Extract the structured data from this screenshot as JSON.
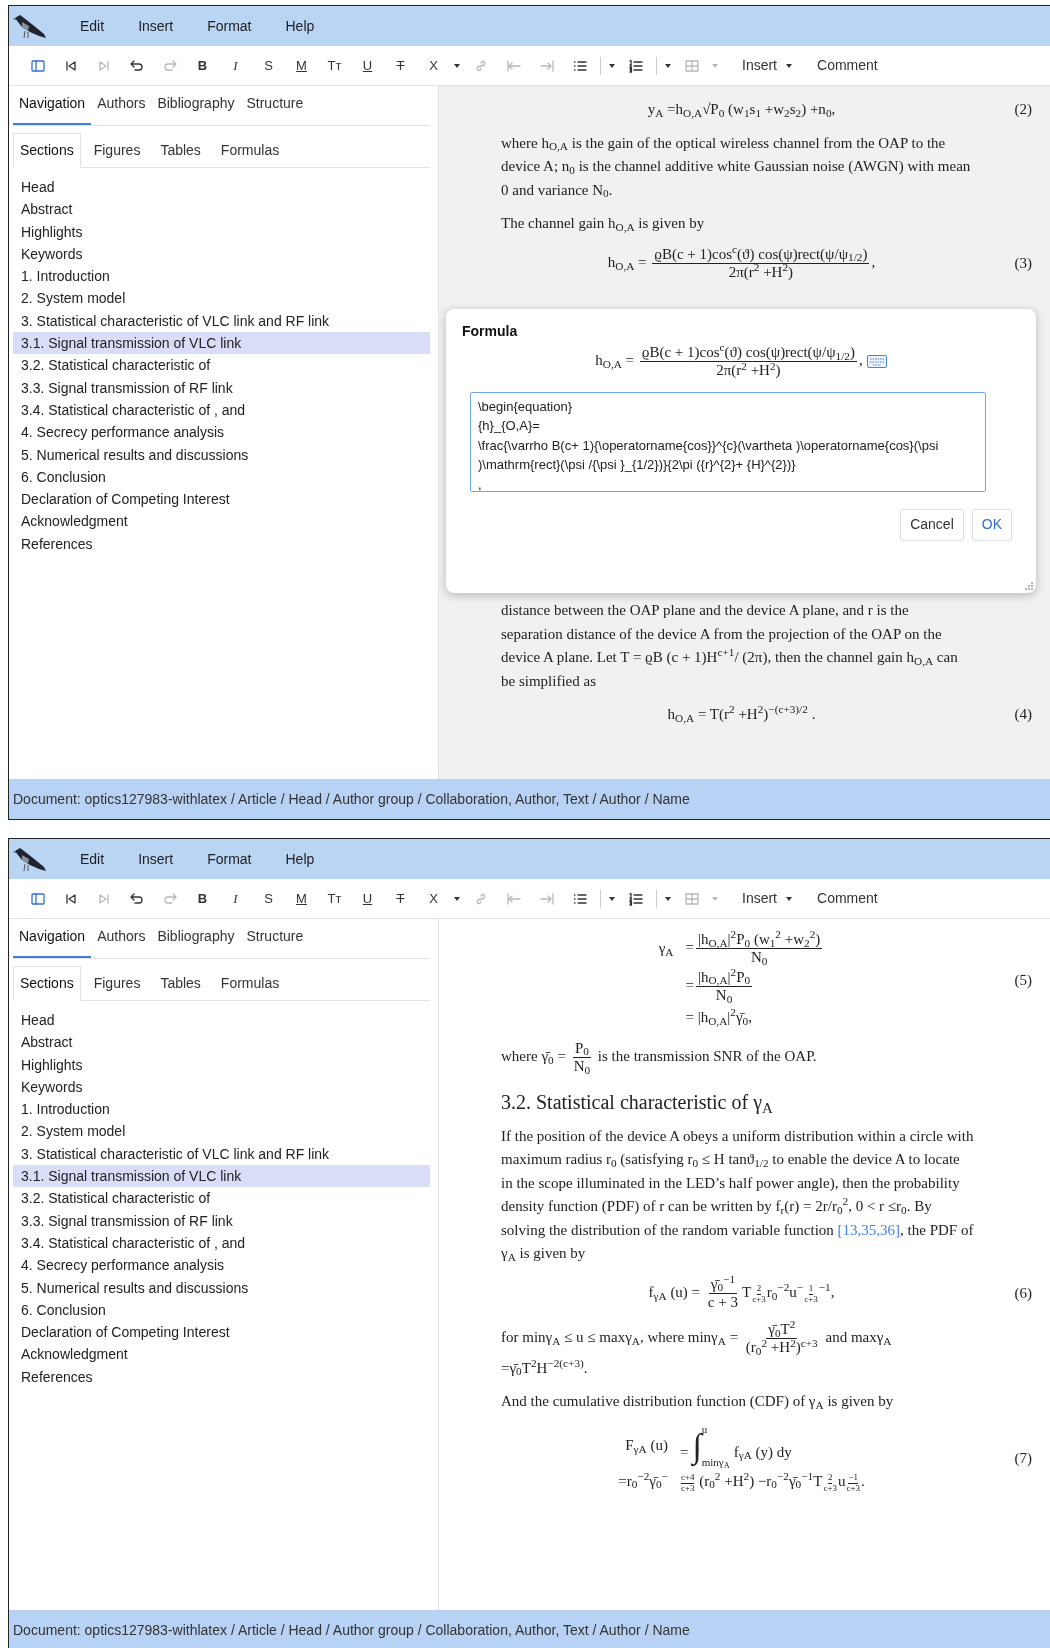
{
  "windows": [
    {
      "menu": [
        "Edit",
        "Insert",
        "Format",
        "Help"
      ],
      "toolbar": [
        {
          "kind": "sidebar",
          "disabled": false
        },
        {
          "kind": "first",
          "disabled": false
        },
        {
          "kind": "last",
          "disabled": true
        },
        {
          "kind": "undo",
          "disabled": false
        },
        {
          "kind": "redo",
          "disabled": true
        },
        {
          "kind": "bold",
          "label": "B",
          "disabled": false
        },
        {
          "kind": "italic",
          "label": "I",
          "disabled": false
        },
        {
          "kind": "plain",
          "label": "S",
          "disabled": false
        },
        {
          "kind": "underline",
          "label": "M",
          "disabled": false
        },
        {
          "kind": "plain",
          "label": "Tᴛ",
          "disabled": false
        },
        {
          "kind": "underline",
          "label": "U",
          "disabled": false
        },
        {
          "kind": "strike",
          "label": "T",
          "disabled": false
        },
        {
          "kind": "plain",
          "label": "X",
          "disabled": false
        },
        {
          "kind": "caret",
          "disabled": false
        },
        {
          "kind": "link",
          "disabled": true
        },
        {
          "kind": "outdent",
          "disabled": true
        },
        {
          "kind": "indent",
          "disabled": true
        },
        {
          "kind": "bullets",
          "disabled": false
        },
        {
          "kind": "sep",
          "disabled": false
        },
        {
          "kind": "caret",
          "disabled": false
        },
        {
          "kind": "numbers",
          "disabled": false
        },
        {
          "kind": "sep",
          "disabled": false
        },
        {
          "kind": "caret",
          "disabled": false
        },
        {
          "kind": "table",
          "disabled": true
        },
        {
          "kind": "caret",
          "disabled": true
        },
        {
          "kind": "menu",
          "label": "Insert",
          "disabled": false
        },
        {
          "kind": "button",
          "label": "Comment",
          "disabled": false
        }
      ],
      "nav_tabs": [
        {
          "label": "Navigation",
          "selected": true
        },
        {
          "label": "Authors",
          "selected": false
        },
        {
          "label": "Bibliography",
          "selected": false
        },
        {
          "label": "Structure",
          "selected": false
        }
      ],
      "sub_tabs": [
        {
          "label": "Sections",
          "selected": true
        },
        {
          "label": "Figures",
          "selected": false
        },
        {
          "label": "Tables",
          "selected": false
        },
        {
          "label": "Formulas",
          "selected": false
        }
      ],
      "sections": [
        {
          "label": "Head",
          "selected": false
        },
        {
          "label": "Abstract",
          "selected": false
        },
        {
          "label": "Highlights",
          "selected": false
        },
        {
          "label": "Keywords",
          "selected": false
        },
        {
          "label": "1. Introduction",
          "selected": false
        },
        {
          "label": "2. System model",
          "selected": false
        },
        {
          "label": "3. Statistical characteristic of VLC link and RF link",
          "selected": false
        },
        {
          "label": "3.1. Signal transmission of VLC link",
          "selected": true
        },
        {
          "label": "3.2. Statistical characteristic of",
          "selected": false
        },
        {
          "label": "3.3. Signal transmission of RF link",
          "selected": false
        },
        {
          "label": "3.4. Statistical characteristic of , and",
          "selected": false
        },
        {
          "label": "4. Secrecy performance analysis",
          "selected": false
        },
        {
          "label": "5. Numerical results and discussions",
          "selected": false
        },
        {
          "label": "6. Conclusion",
          "selected": false
        },
        {
          "label": "Declaration of Competing Interest",
          "selected": false
        },
        {
          "label": "Acknowledgment",
          "selected": false
        },
        {
          "label": "References",
          "selected": false
        }
      ],
      "document": [
        {
          "kind": "equation",
          "number": "(2)",
          "lines": [
            [
              {
                "kind": "text",
                "text": "y$_{A}$ =h$_{O,A}$√P$_{0}$ (w$_{1}$s$_{1}$ +w$_{2}$s$_{2}$) +n$_{0}$,"
              }
            ]
          ]
        },
        {
          "kind": "paragraph",
          "parts": [
            {
              "kind": "text",
              "text": "where h$_{O,A}$ is the gain of the optical wireless channel from the OAP to the device A; n$_{0}$ is the channel additive white Gaussian noise (AWGN) with mean 0 and variance N$_{0}$."
            }
          ]
        },
        {
          "kind": "paragraph",
          "parts": [
            {
              "kind": "text",
              "text": "The channel gain h$_{O,A}$ is given by"
            }
          ]
        },
        {
          "kind": "equation",
          "number": "(3)",
          "lines": [
            [
              {
                "kind": "text",
                "text": "h$_{O,A}$ = "
              },
              {
                "kind": "frac",
                "num": "ϱB(c + 1)cos$^{c}$(ϑ) cos(ψ)rect(ψ/ψ$_{1/2}$)",
                "den": "2π(r$^{2}$ +H$^{2}$)"
              },
              {
                "kind": "text",
                "text": ","
              }
            ]
          ]
        },
        {
          "kind": "hidden"
        },
        {
          "kind": "paragraph",
          "parts": [
            {
              "kind": "text",
              "text": "distance between the OAP plane and the device A plane, and r is the separation distance of the device A from the projection of the OAP on the device A plane. Let T = ϱB (c + 1)H$^{c+1}$/ (2π), then the channel gain h$_{O,A}$ can be simplified as"
            }
          ]
        },
        {
          "kind": "equation",
          "number": "(4)",
          "lines": [
            [
              {
                "kind": "text",
                "text": "h$_{O,A}$ = T(r$^{2}$ +H$^{2}$)$^{−(c+3)/2}$ ."
              }
            ]
          ]
        }
      ],
      "dialog": {
        "title": "Formula",
        "preview": [
          {
            "kind": "text",
            "text": "h$_{O,A}$ = "
          },
          {
            "kind": "frac",
            "num": "ϱB(c + 1)cos$^{c}$(ϑ) cos(ψ)rect(ψ/ψ$_{1/2}$)",
            "den": "2π(r$^{2}$ +H$^{2}$)"
          },
          {
            "kind": "text",
            "text": ","
          }
        ],
        "latex": "\\begin{equation}\n{h}_{O,A}=\n\\frac{\\varrho B(c+ 1){\\operatorname{cos}}^{c}(\\vartheta )\\operatorname{cos}(\\psi )\\mathrm{rect}(\\psi /{\\psi }_{1/2})}{2\\pi ({r}^{2}+ {H}^{2})}\n,",
        "buttons": [
          "Cancel",
          "OK"
        ]
      },
      "status_bar": "Document: optics127983-withlatex / Article / Head / Author group / Collaboration, Author, Text / Author / Name"
    },
    {
      "menu": [
        "Edit",
        "Insert",
        "Format",
        "Help"
      ],
      "toolbar": [
        {
          "kind": "sidebar",
          "disabled": false
        },
        {
          "kind": "first",
          "disabled": false
        },
        {
          "kind": "last",
          "disabled": true
        },
        {
          "kind": "undo",
          "disabled": false
        },
        {
          "kind": "redo",
          "disabled": true
        },
        {
          "kind": "bold",
          "label": "B",
          "disabled": false
        },
        {
          "kind": "italic",
          "label": "I",
          "disabled": false
        },
        {
          "kind": "plain",
          "label": "S",
          "disabled": false
        },
        {
          "kind": "underline",
          "label": "M",
          "disabled": false
        },
        {
          "kind": "plain",
          "label": "Tᴛ",
          "disabled": false
        },
        {
          "kind": "underline",
          "label": "U",
          "disabled": false
        },
        {
          "kind": "strike",
          "label": "T",
          "disabled": false
        },
        {
          "kind": "plain",
          "label": "X",
          "disabled": false
        },
        {
          "kind": "caret",
          "disabled": false
        },
        {
          "kind": "link",
          "disabled": true
        },
        {
          "kind": "outdent",
          "disabled": true
        },
        {
          "kind": "indent",
          "disabled": true
        },
        {
          "kind": "bullets",
          "disabled": false
        },
        {
          "kind": "sep",
          "disabled": false
        },
        {
          "kind": "caret",
          "disabled": false
        },
        {
          "kind": "numbers",
          "disabled": false
        },
        {
          "kind": "sep",
          "disabled": false
        },
        {
          "kind": "caret",
          "disabled": false
        },
        {
          "kind": "table",
          "disabled": true
        },
        {
          "kind": "caret",
          "disabled": true
        },
        {
          "kind": "menu",
          "label": "Insert",
          "disabled": false
        },
        {
          "kind": "button",
          "label": "Comment",
          "disabled": false
        }
      ],
      "nav_tabs": [
        {
          "label": "Navigation",
          "selected": true
        },
        {
          "label": "Authors",
          "selected": false
        },
        {
          "label": "Bibliography",
          "selected": false
        },
        {
          "label": "Structure",
          "selected": false
        }
      ],
      "sub_tabs": [
        {
          "label": "Sections",
          "selected": true
        },
        {
          "label": "Figures",
          "selected": false
        },
        {
          "label": "Tables",
          "selected": false
        },
        {
          "label": "Formulas",
          "selected": false
        }
      ],
      "sections": [
        {
          "label": "Head",
          "selected": false
        },
        {
          "label": "Abstract",
          "selected": false
        },
        {
          "label": "Highlights",
          "selected": false
        },
        {
          "label": "Keywords",
          "selected": false
        },
        {
          "label": "1. Introduction",
          "selected": false
        },
        {
          "label": "2. System model",
          "selected": false
        },
        {
          "label": "3. Statistical characteristic of VLC link and RF link",
          "selected": false
        },
        {
          "label": "3.1. Signal transmission of VLC link",
          "selected": true
        },
        {
          "label": "3.2. Statistical characteristic of",
          "selected": false
        },
        {
          "label": "3.3. Signal transmission of RF link",
          "selected": false
        },
        {
          "label": "3.4. Statistical characteristic of , and",
          "selected": false
        },
        {
          "label": "4. Secrecy performance analysis",
          "selected": false
        },
        {
          "label": "5. Numerical results and discussions",
          "selected": false
        },
        {
          "label": "6. Conclusion",
          "selected": false
        },
        {
          "label": "Declaration of Competing Interest",
          "selected": false
        },
        {
          "label": "Acknowledgment",
          "selected": false
        },
        {
          "label": "References",
          "selected": false
        }
      ],
      "document": [
        {
          "kind": "equation",
          "number": "(5)",
          "lines": [
            [
              {
                "kind": "text",
                "text": "γ$_{A}$"
              },
              {
                "kind": "text",
                "text": "="
              },
              {
                "kind": "frac",
                "num": "|h$_{O,A}$|$^{2}$P$_{0}$ (w$_{1}$$^{2}$ +w$_{2}$$^{2}$)",
                "den": "N$_{0}$"
              }
            ],
            [
              {
                "kind": "text",
                "text": "="
              },
              {
                "kind": "frac",
                "num": "|h$_{O,A}$|$^{2}$P$_{0}$",
                "den": "N$_{0}$"
              }
            ],
            [
              {
                "kind": "text",
                "text": "= |h$_{O,A}$|$^{2}$γ̄$_{0}$,"
              }
            ]
          ]
        },
        {
          "kind": "paragraph",
          "parts": [
            {
              "kind": "text",
              "text": "where γ̄$_{0}$ = "
            },
            {
              "kind": "frac",
              "num": "P$_{0}$",
              "den": "N$_{0}$"
            },
            {
              "kind": "text",
              "text": " is the transmission SNR of the OAP."
            }
          ]
        },
        {
          "kind": "heading",
          "text": "3.2. Statistical characteristic of γ$_{A}$"
        },
        {
          "kind": "paragraph",
          "parts": [
            {
              "kind": "text",
              "text": "If the position of the device A obeys a uniform distribution within a circle with maximum radius r$_{0}$ (satisfying r$_{0}$ ≤ H tanϑ$_{1/2}$ to enable the device A to locate in the scope illuminated in the LED’s half power angle), then the probability density function (PDF) of r can be written by f$_{r}$(r) = 2r/r$_{0}$$^{2}$, 0 < r ≤r$_{0}$. By solving the distribution of the random variable function "
            },
            {
              "kind": "link",
              "text": "[13,35,36]"
            },
            {
              "kind": "text",
              "text": ", the PDF of γ$_{A}$ is given by"
            }
          ]
        },
        {
          "kind": "equation",
          "number": "(6)",
          "lines": [
            [
              {
                "kind": "text",
                "text": "f$_{γA}$ (u) = "
              },
              {
                "kind": "frac",
                "num": "γ̄$_{0}$$^{−1}$",
                "den": "c + 3"
              },
              {
                "kind": "text",
                "text": "T"
              },
              {
                "kind": "supfrac",
                "num": "2",
                "den": "c+3"
              },
              {
                "kind": "text",
                "text": "r$_{0}$$^{−2}$u$^{−}$"
              },
              {
                "kind": "supfrac",
                "num": "1",
                "den": "c+3"
              },
              {
                "kind": "text",
                "text": "$^{−1}$,"
              }
            ]
          ]
        },
        {
          "kind": "paragraph",
          "parts": [
            {
              "kind": "text",
              "text": "for minγ$_{A}$ ≤ u ≤ maxγ$_{A}$, where minγ$_{A}$ = "
            },
            {
              "kind": "frac",
              "num": "γ̄$_{0}$T$^{2}$",
              "den": "(r$_{0}$$^{2}$ +H$^{2}$)$^{c+3}$"
            },
            {
              "kind": "text",
              "text": " and maxγ$_{A}$ =γ̄$_{0}$T$^{2}$H$^{−2(c+3)}$."
            }
          ]
        },
        {
          "kind": "paragraph",
          "parts": [
            {
              "kind": "text",
              "text": "And the cumulative distribution function (CDF) of γ$_{A}$ is given by"
            }
          ]
        },
        {
          "kind": "equation",
          "number": "(7)",
          "lines": [
            [
              {
                "kind": "text",
                "text": "F$_{γA}$ (u)"
              },
              {
                "kind": "text",
                "text": "="
              },
              {
                "kind": "int",
                "sign": "∫",
                "hi": "u",
                "lo": "minγ$_{A}$"
              },
              {
                "kind": "text",
                "text": "f$_{γA}$ (y) dy"
              }
            ],
            [
              {
                "kind": "text",
                "text": "=r$_{0}$$^{−2}$γ̄$_{0}$$^{−}$"
              },
              {
                "kind": "supfrac",
                "num": "c+4",
                "den": "c+3"
              },
              {
                "kind": "text",
                "text": " (r$_{0}$$^{2}$ +H$^{2}$) −r$_{0}$$^{−2}$γ̄$_{0}$$^{−1}$T"
              },
              {
                "kind": "supfrac",
                "num": "2",
                "den": "c+3"
              },
              {
                "kind": "text",
                "text": "u"
              },
              {
                "kind": "supfrac",
                "num": "−1",
                "den": "c+3"
              },
              {
                "kind": "text",
                "text": "."
              }
            ]
          ]
        }
      ],
      "status_bar": "Document: optics127983-withlatex / Article / Head / Author group / Collaboration, Author, Text / Author / Name"
    }
  ]
}
